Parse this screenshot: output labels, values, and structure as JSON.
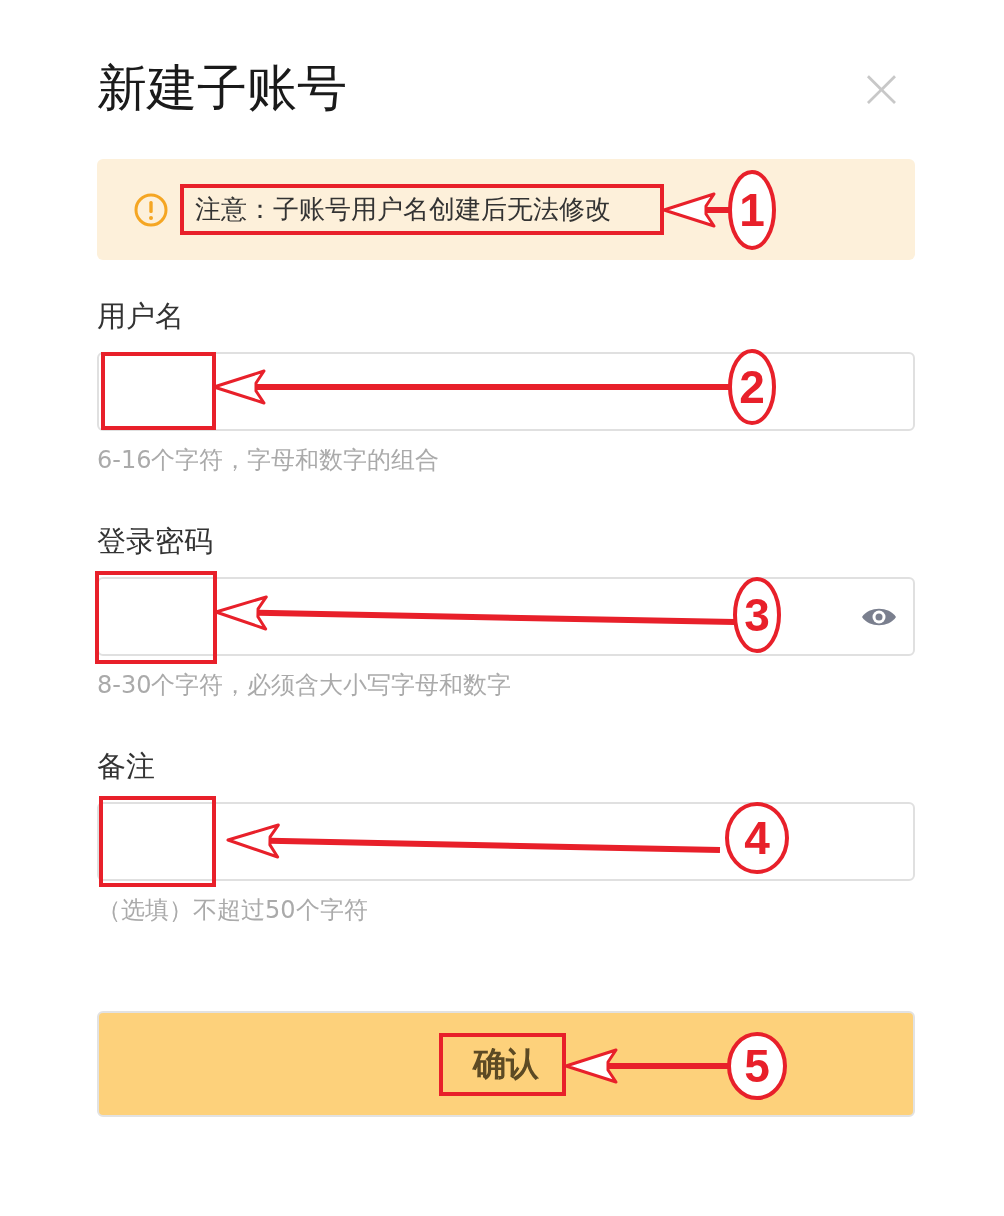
{
  "dialog": {
    "title": "新建子账号",
    "close": "×"
  },
  "notice": {
    "text": "注意：子账号用户名创建后无法修改"
  },
  "fields": [
    {
      "label": "用户名",
      "kind": "text",
      "hint": "6-16个字符，字母和数字的组合"
    },
    {
      "label": "登录密码",
      "kind": "password",
      "hint": "8-30个字符，必须含大小写字母和数字"
    },
    {
      "label": "备注",
      "kind": "text",
      "hint": "（选填）不超过50个字符"
    }
  ],
  "confirm_button": "确认",
  "annotations": [
    {
      "label": "1"
    },
    {
      "label": "2"
    },
    {
      "label": "3"
    },
    {
      "label": "4"
    },
    {
      "label": "5"
    }
  ]
}
